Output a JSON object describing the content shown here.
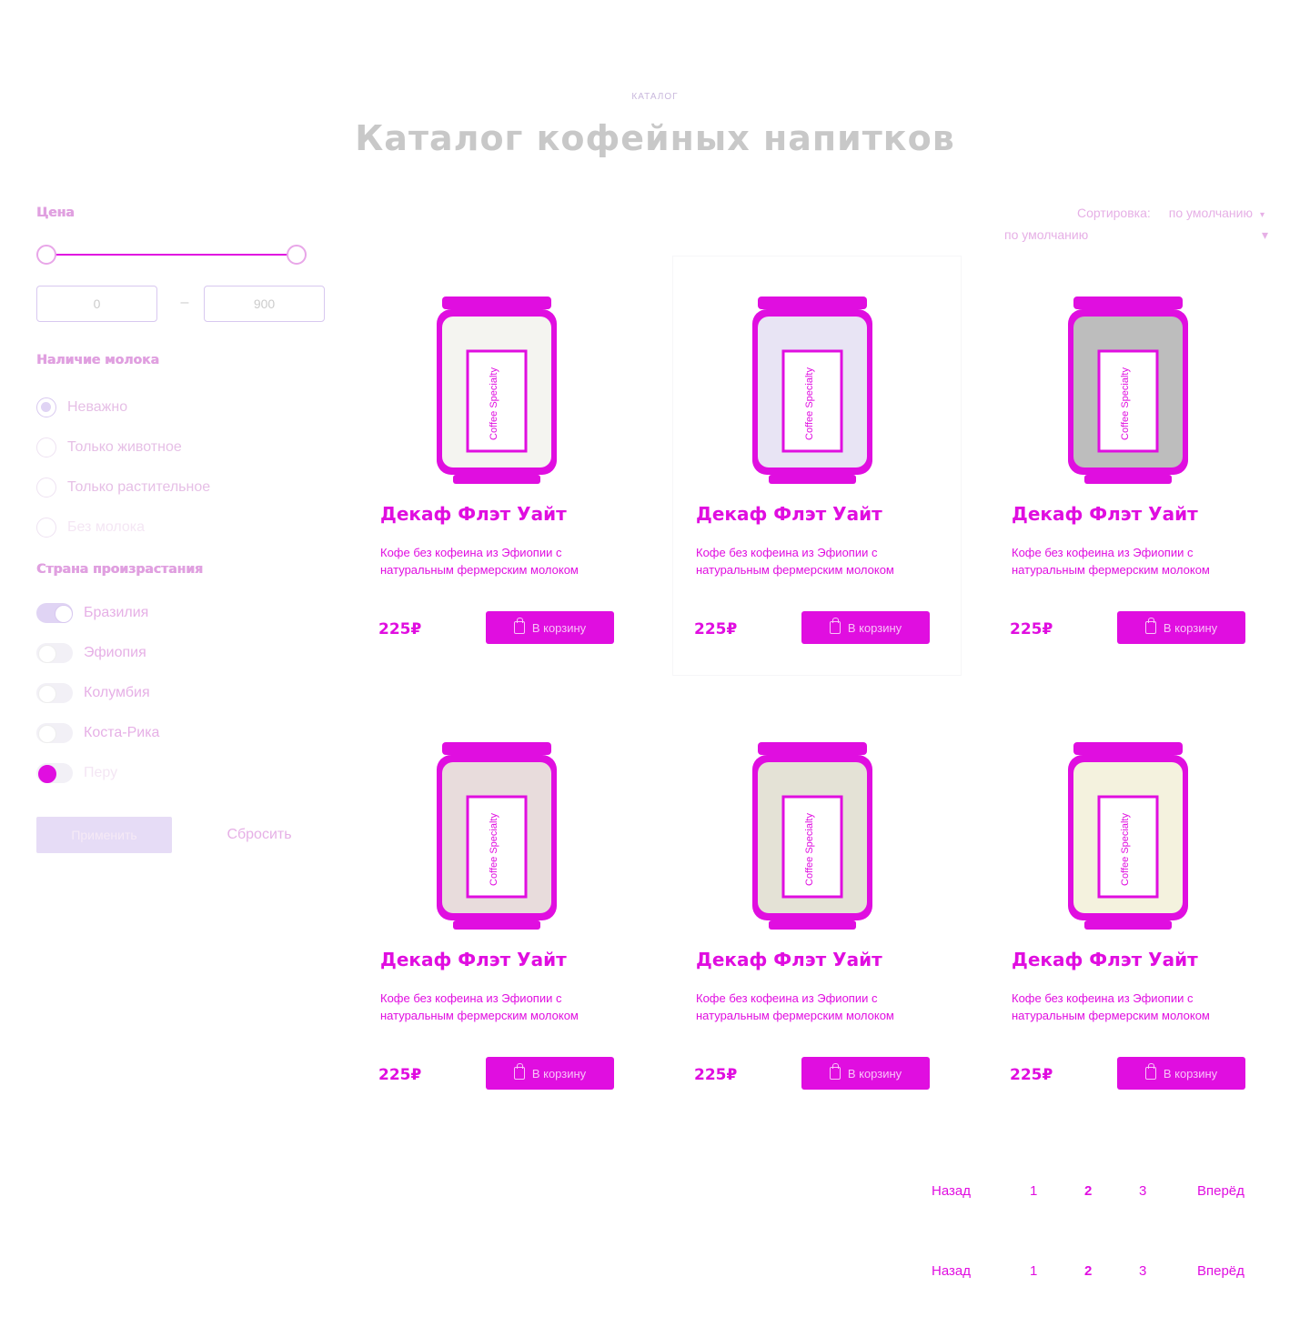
{
  "header": {
    "eyebrow": "КАТАЛОГ",
    "title": "Каталог кофейных напитков"
  },
  "filters": {
    "price": {
      "title": "Цена",
      "from": "0",
      "to": "900",
      "separator": "–"
    },
    "milk": {
      "title": "Наличие молока",
      "options": [
        "Неважно",
        "Только животное",
        "Только растительное",
        "Без молока"
      ],
      "selected_index": 0
    },
    "country": {
      "title": "Страна произрастания",
      "options": [
        "Бразилия",
        "Эфиопия",
        "Колумбия",
        "Коста-Рика",
        "Перу"
      ],
      "enabled": [
        true,
        false,
        false,
        false,
        false
      ]
    },
    "apply_label": "Применить",
    "reset_label": "Сбросить"
  },
  "sort": {
    "label": "Сортировка:",
    "value": "по умолчанию"
  },
  "products": [
    {
      "name": "Декаф Флэт Уайт",
      "description": "Кофе без кофеина из Эфиопии с натуральным фермерским молоком",
      "price": "225₽",
      "cart_label": "В корзину"
    },
    {
      "name": "Декаф Флэт Уайт",
      "description": "Кофе без кофеина из Эфиопии с натуральным фермерским молоком",
      "price": "225₽",
      "cart_label": "В корзину"
    },
    {
      "name": "Декаф Флэт Уайт",
      "description": "Кофе без кофеина из Эфиопии с натуральным фермерским молоком",
      "price": "225₽",
      "cart_label": "В корзину"
    },
    {
      "name": "Декаф Флэт Уайт",
      "description": "Кофе без кофеина из Эфиопии с натуральным фермерским молоком",
      "price": "225₽",
      "cart_label": "В корзину"
    },
    {
      "name": "Декаф Флэт Уайт",
      "description": "Кофе без кофеина из Эфиопии с натуральным фермерским молоком",
      "price": "225₽",
      "cart_label": "В корзину"
    },
    {
      "name": "Декаф Флэт Уайт",
      "description": "Кофе без кофеина из Эфиопии с натуральным фермерским молоком",
      "price": "225₽",
      "cart_label": "В корзину"
    }
  ],
  "can_label": "Coffee Specialty",
  "can_colors": [
    "#f4f4f0",
    "#e8e4f4",
    "#bdbdbd",
    "#e8dcdc",
    "#e4e2d6",
    "#f4f2de"
  ],
  "pagination": {
    "prev": "Назад",
    "pages": [
      "1",
      "2",
      "3"
    ],
    "active_index": 1,
    "next": "Вперёд"
  },
  "colors": {
    "accent": "#e00ee0",
    "muted": "#e6b0e6",
    "title_gray": "#c8c8c8"
  }
}
